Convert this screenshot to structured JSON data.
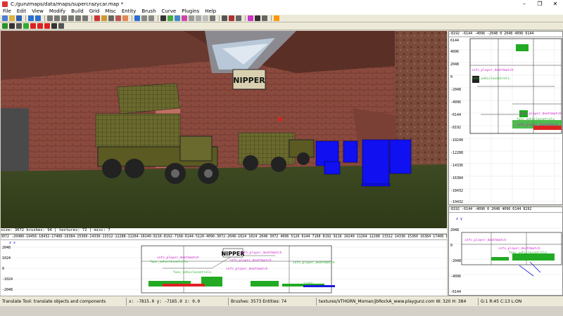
{
  "window": {
    "title": "C:/gunzmaps/data/maps/supercrazycar.map *",
    "min_glyph": "–",
    "max_glyph": "❐",
    "close_glyph": "✕"
  },
  "menu": [
    "File",
    "Edit",
    "View",
    "Modify",
    "Build",
    "Grid",
    "Misc",
    "Entity",
    "Brush",
    "Curve",
    "Plugins",
    "Help"
  ],
  "viewport3d": {
    "sign_text": "NIPPER",
    "status": "size: 3072  brushes: 94  | textures: 72  | misc: 7"
  },
  "front_view": {
    "ruler": "3072 -20480-19456-18432-17408-16384-15360-14336-13312-12288-11264-10240-9216-8192-7168-6144-5120-4096-3072-2048-1024    1024  2048  3072  4096  5120  6144  7168  8192  9216  10240 11264 12288 13312 14336 15360 16384 17408 18432 19456 20480 22",
    "side_labels": [
      "2048",
      "1024",
      "0",
      "-1024",
      "-2048"
    ],
    "axis_label": "z  x",
    "sign_text": "NIPPER",
    "entity_labels": [
      "info_player_deathmatch",
      "func_vehiclecontrols",
      "info_player_deathmatch",
      "info_player_deathmatch",
      "func_vehiclecontrols",
      "info_player_deathmatch",
      "info_player_deathmatch",
      "light"
    ]
  },
  "top_view": {
    "ruler": "-8192 -6144 -4096 -2048  0  2048 4096 6144",
    "side_labels": [
      "6144",
      "4096",
      "2048",
      "0",
      "-2048",
      "-4096",
      "-6144",
      "-8192",
      "-10240",
      "-12288",
      "-14336",
      "-16384",
      "-18432",
      "-19432"
    ],
    "entity_labels": [
      "info_player_deathmatch",
      "func_vehiclecontrols",
      "info_player_deathmatch",
      "func_vehiclecontrols",
      "info_player_deathmatch"
    ]
  },
  "side_view": {
    "ruler": "-8192 -6144 -4096  0  2048  4096 6144 8192",
    "side_labels": [
      "2048",
      "0",
      "-2048",
      "-4096",
      "-6144"
    ],
    "axis_label": "z  y",
    "entity_labels": [
      "info_player_deathmatch",
      "info_player_deathmatch",
      "func_vehiclecontrols"
    ]
  },
  "status": {
    "tool_hint": "Translate Tool: translate objects and components",
    "coords": "x:   -7815.0  y:   -7165.0  z:    0.0",
    "counts": "Brushes: 3573  Entities: 74",
    "texture": "textures/VTHGRN_Moman/jbRockA_www.playgunz.com W: 320 H: 384",
    "grid": "G:1  R:45  C:13  L:ON"
  },
  "colors": {
    "chrome": "#d4d0c8",
    "toolbar": "#ece9d8",
    "entity_green": "#22cc22",
    "entity_magenta": "#cc22cc",
    "brush_blue": "#0000ff"
  }
}
